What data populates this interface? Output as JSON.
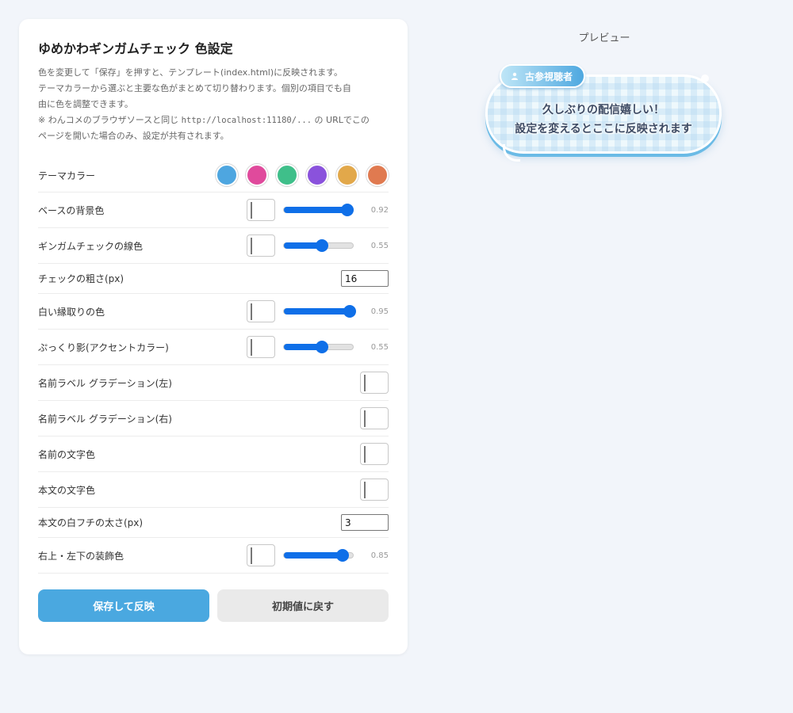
{
  "settings": {
    "title": "ゆめかわギンガムチェック 色設定",
    "desc": {
      "line1": "色を変更して「保存」を押すと、テンプレート(index.html)に反映されます。",
      "line2": "テーマカラーから選ぶと主要な色がまとめて切り替わります。個別の項目でも自",
      "line3": "由に色を調整できます。",
      "line4_prefix": "※ わんコメのブラウザソースと同じ ",
      "line4_url": "http://localhost:11180/...",
      "line4_suffix": " の URLでこの",
      "line5": "ページを開いた場合のみ、設定が共有されます。"
    },
    "theme": {
      "label": "テーマカラー",
      "colors": [
        "#4ea6e0",
        "#e04a9c",
        "#3fbf8a",
        "#8a52dc",
        "#e2a84a",
        "#e07a50"
      ]
    },
    "rows": {
      "base_bg": {
        "label": "ベースの背景色",
        "color": "#e9f7fb",
        "opacity": 0.92,
        "value_text": "0.92"
      },
      "gingham_line": {
        "label": "ギンガムチェックの線色",
        "color": "#ffffff",
        "opacity": 0.55,
        "value_text": "0.55"
      },
      "check_size": {
        "label": "チェックの粗さ(px)",
        "value": "16"
      },
      "white_border": {
        "label": "白い縁取りの色",
        "color": "#ffffff",
        "opacity": 0.95,
        "value_text": "0.95"
      },
      "puffy_shadow": {
        "label": "ぷっくり影(アクセントカラー)",
        "color": "#6abaea",
        "opacity": 0.55,
        "value_text": "0.55"
      },
      "name_grad_left": {
        "label": "名前ラベル グラデーション(左)",
        "color": "#bde7f7"
      },
      "name_grad_right": {
        "label": "名前ラベル グラデーション(右)",
        "color": "#4ea8e0"
      },
      "name_text": {
        "label": "名前の文字色",
        "color": "#ffffff"
      },
      "body_text": {
        "label": "本文の文字色",
        "color": "#3d4a63"
      },
      "body_outline": {
        "label": "本文の白フチの太さ(px)",
        "value": "3"
      },
      "deco_color": {
        "label": "右上・左下の装飾色",
        "color": "#ffffff",
        "opacity": 0.85,
        "value_text": "0.85"
      }
    },
    "buttons": {
      "save_label": "保存して反映",
      "reset_label": "初期値に戻す"
    }
  },
  "preview": {
    "title": "プレビュー",
    "name_label": "古参視聴者",
    "message_line1": "久しぶりの配信嬉しい！",
    "message_line2": "設定を変えるとここに反映されます"
  },
  "icons": {
    "name_label_icon": "user-icon"
  }
}
